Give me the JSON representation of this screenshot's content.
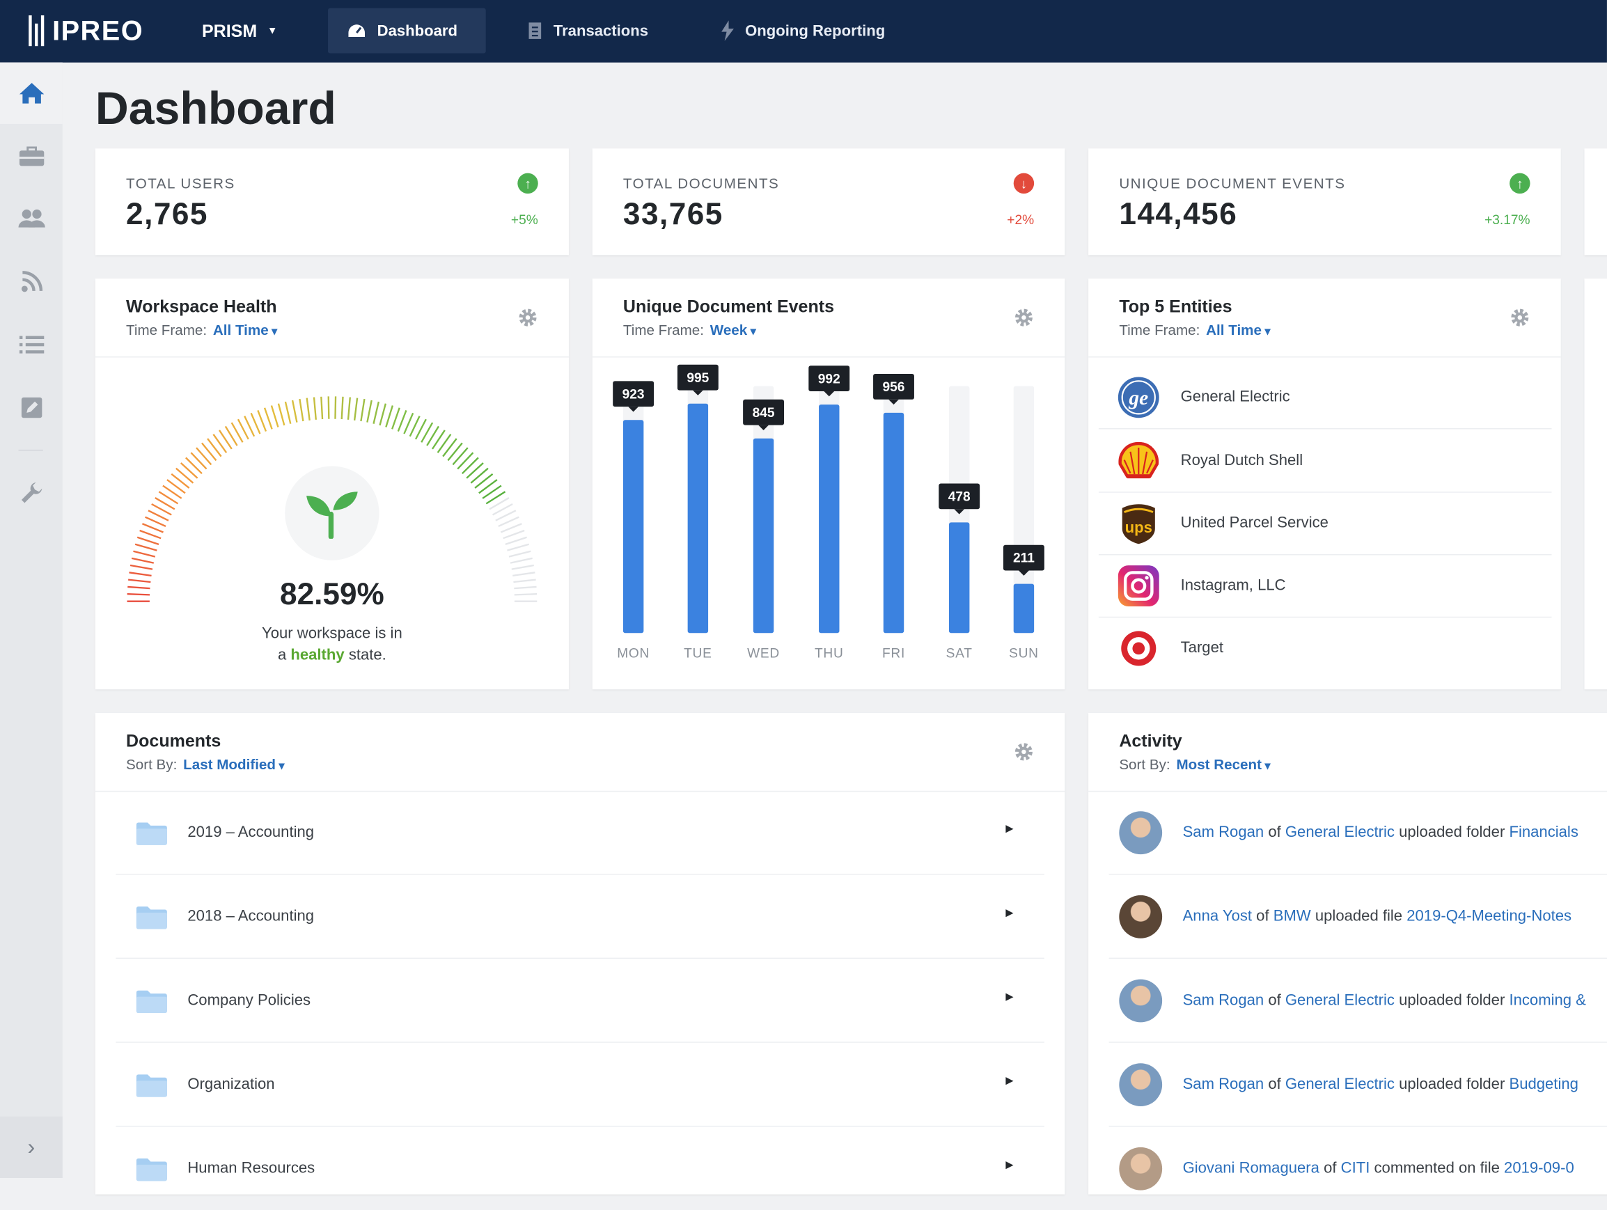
{
  "brand": {
    "logo_text": "IPREO"
  },
  "topnav": {
    "app_label": "PRISM",
    "tabs": [
      {
        "label": "Dashboard"
      },
      {
        "label": "Transactions"
      },
      {
        "label": "Ongoing Reporting"
      }
    ]
  },
  "sidebar": {
    "items": [
      "home-icon",
      "briefcase-icon",
      "users-icon",
      "rss-icon",
      "list-icon",
      "edit-icon",
      "wrench-icon"
    ]
  },
  "page": {
    "title": "Dashboard"
  },
  "stats": [
    {
      "label": "TOTAL USERS",
      "value": "2,765",
      "change": "+5%",
      "direction": "up"
    },
    {
      "label": "TOTAL DOCUMENTS",
      "value": "33,765",
      "change": "+2%",
      "direction": "down"
    },
    {
      "label": "UNIQUE DOCUMENT EVENTS",
      "value": "144,456",
      "change": "+3.17%",
      "direction": "up"
    }
  ],
  "colors": {
    "navy": "#12284a",
    "accent": "#2a6ebb",
    "bar": "#3b82e0",
    "up": "#4caf50",
    "down": "#e24a3b",
    "healthy": "#5aa832"
  },
  "health": {
    "title": "Workspace Health",
    "timeframe_label": "Time Frame:",
    "timeframe_value": "All Time",
    "percent": 0.8259,
    "value_text": "82.59%",
    "msg_line1": "Your workspace is in",
    "msg_prefix": "a",
    "msg_status": "healthy",
    "msg_suffix": "state."
  },
  "events": {
    "title": "Unique Document Events",
    "timeframe_label": "Time Frame:",
    "timeframe_value": "Week"
  },
  "chart_data": {
    "type": "bar",
    "categories": [
      "MON",
      "TUE",
      "WED",
      "THU",
      "FRI",
      "SAT",
      "SUN"
    ],
    "values": [
      923,
      995,
      845,
      992,
      956,
      478,
      211
    ],
    "ylim": [
      0,
      1070
    ]
  },
  "entities": {
    "title": "Top 5 Entities",
    "timeframe_label": "Time Frame:",
    "timeframe_value": "All Time",
    "items": [
      {
        "name": "General Electric",
        "icon": "ge-logo-icon"
      },
      {
        "name": "Royal Dutch Shell",
        "icon": "shell-logo-icon"
      },
      {
        "name": "United Parcel Service",
        "icon": "ups-logo-icon"
      },
      {
        "name": "Instagram, LLC",
        "icon": "instagram-logo-icon"
      },
      {
        "name": "Target",
        "icon": "target-logo-icon"
      }
    ]
  },
  "documents": {
    "title": "Documents",
    "sort_label": "Sort By:",
    "sort_value": "Last Modified",
    "items": [
      "2019 – Accounting",
      "2018 – Accounting",
      "Company Policies",
      "Organization",
      "Human Resources"
    ]
  },
  "activity": {
    "title": "Activity",
    "sort_label": "Sort By:",
    "sort_value": "Most Recent",
    "items": [
      {
        "user": "Sam Rogan",
        "of": "of",
        "org": "General Electric",
        "action": "uploaded folder",
        "target": "Financials"
      },
      {
        "user": "Anna Yost",
        "of": "of",
        "org": "BMW",
        "action": "uploaded file",
        "target": "2019-Q4-Meeting-Notes"
      },
      {
        "user": "Sam Rogan",
        "of": "of",
        "org": "General Electric",
        "action": "uploaded folder",
        "target": "Incoming &"
      },
      {
        "user": "Sam Rogan",
        "of": "of",
        "org": "General Electric",
        "action": "uploaded folder",
        "target": "Budgeting"
      },
      {
        "user": "Giovani Romaguera",
        "of": "of",
        "org": "CITI",
        "action": "commented on file",
        "target": "2019-09-0"
      }
    ]
  }
}
